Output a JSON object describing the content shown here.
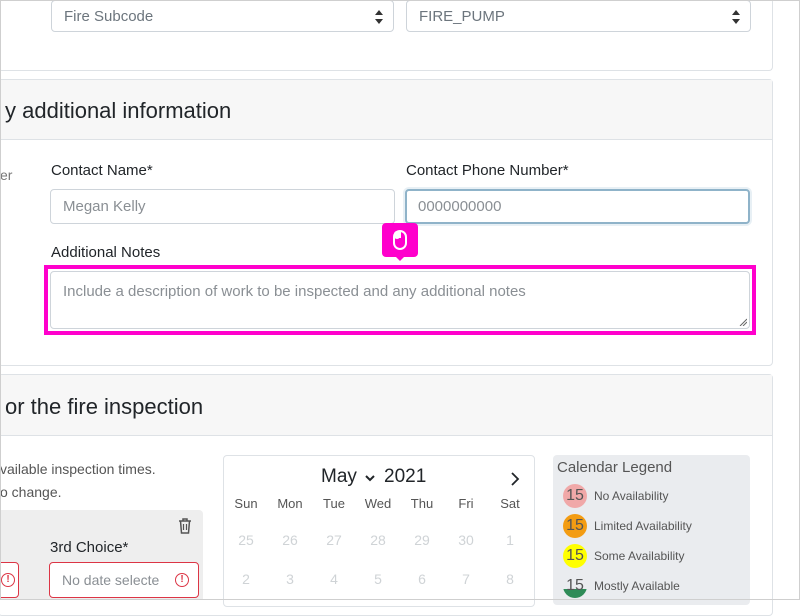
{
  "top_selects": {
    "subcode": "Fire Subcode",
    "system": "FIRE_PUMP"
  },
  "contact_section": {
    "title": "y additional information",
    "side_label": "er",
    "contact_name": {
      "label": "Contact Name*",
      "value": "Megan Kelly"
    },
    "contact_phone": {
      "label": "Contact Phone Number*",
      "value": "0000000000"
    },
    "notes": {
      "label": "Additional Notes",
      "placeholder": "Include a description of work to be inspected and any additional notes"
    }
  },
  "schedule_section": {
    "title": "or the fire inspection",
    "info_line1": "vailable inspection times.",
    "info_line2": "o change.",
    "third_choice_label": "3rd Choice*",
    "third_choice_placeholder": "No date selecte"
  },
  "calendar": {
    "month": "May",
    "year": "2021",
    "days_of_week": [
      "Sun",
      "Mon",
      "Tue",
      "Wed",
      "Thu",
      "Fri",
      "Sat"
    ],
    "week1": [
      "25",
      "26",
      "27",
      "28",
      "29",
      "30",
      "1"
    ],
    "week2": [
      "2",
      "3",
      "4",
      "5",
      "6",
      "7",
      "8"
    ]
  },
  "legend": {
    "title": "Calendar Legend",
    "items": [
      {
        "day": "15",
        "label": "No Availability",
        "color": "#f0a8a8"
      },
      {
        "day": "15",
        "label": "Limited Availability",
        "color": "#f39c12"
      },
      {
        "day": "15",
        "label": "Some Availability",
        "color": "#ffff00"
      },
      {
        "day": "15",
        "label": "Mostly Available",
        "color": "#2e8b57"
      }
    ]
  },
  "colors": {
    "highlight": "#ff00cc",
    "error": "#dc3545"
  }
}
